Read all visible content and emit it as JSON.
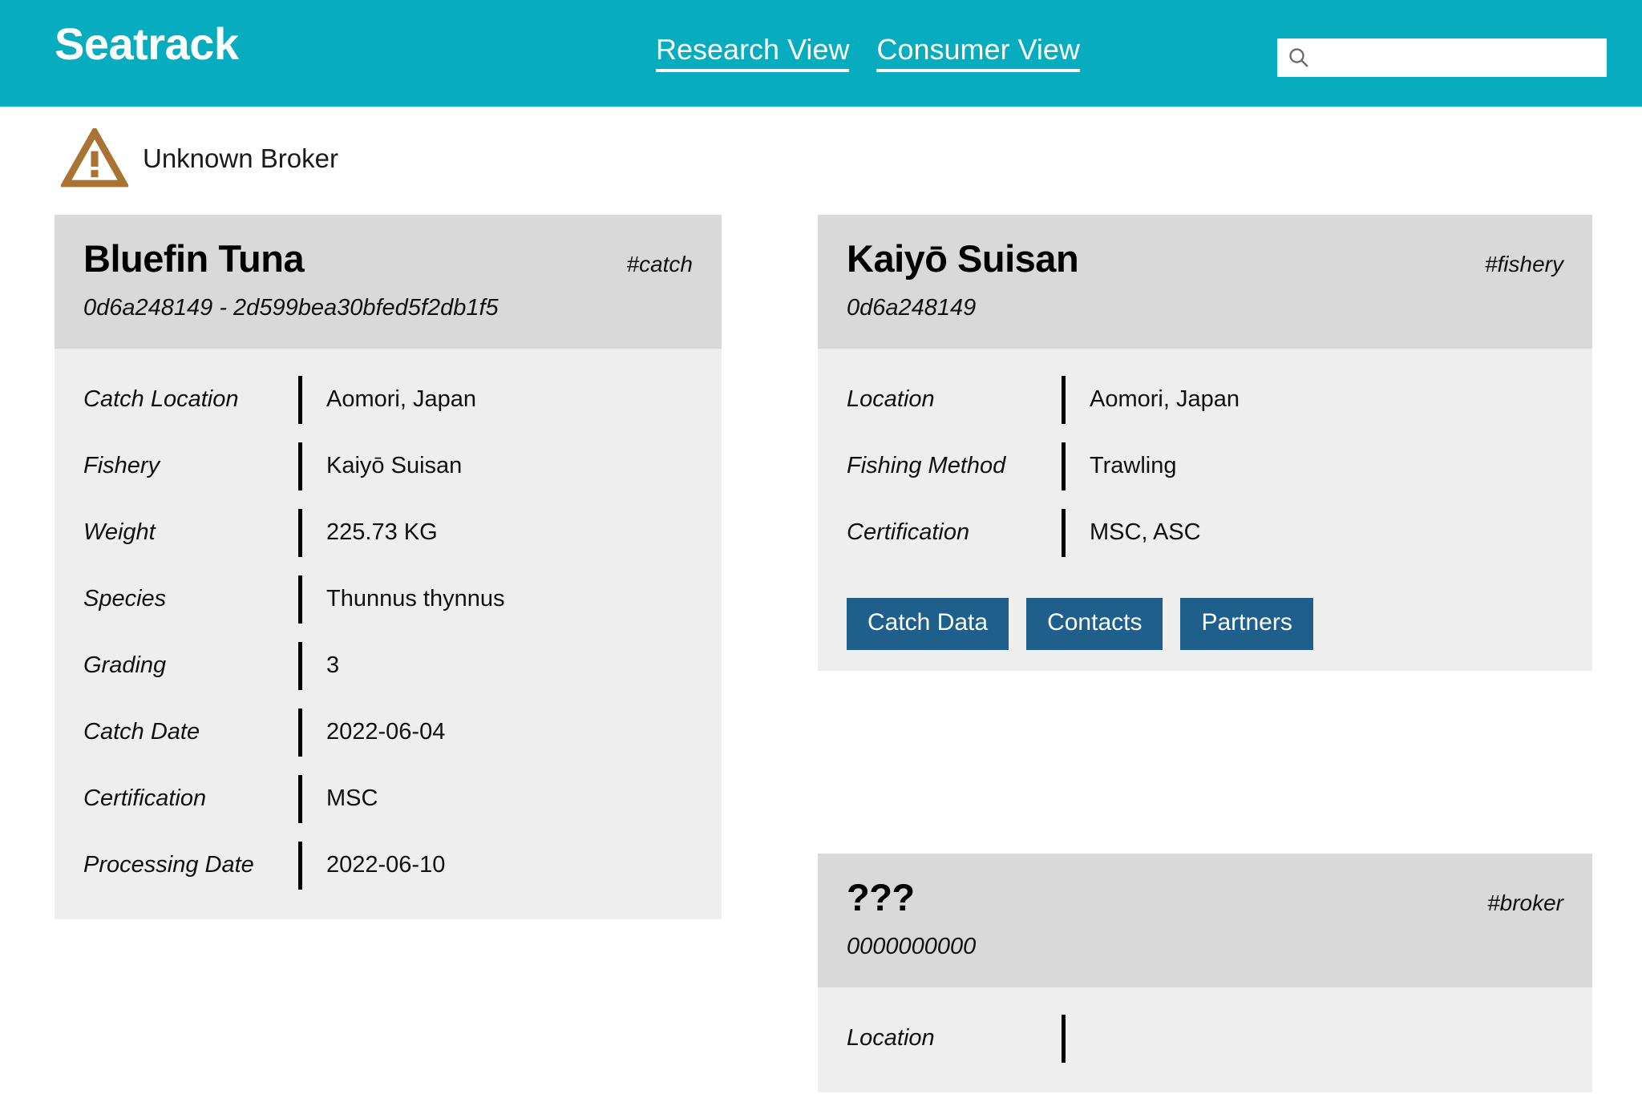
{
  "header": {
    "brand": "Seatrack",
    "brand_color": "#07adbf",
    "nav": [
      {
        "label": "Research View"
      },
      {
        "label": "Consumer View"
      }
    ],
    "search": {
      "value": "",
      "placeholder": "",
      "icon": "search-icon"
    }
  },
  "warning": {
    "icon": "warning-triangle-icon",
    "icon_color": "#a87333",
    "text": "Unknown Broker"
  },
  "cards": {
    "catch": {
      "title": "Bluefin Tuna",
      "tag": "#catch",
      "id": "0d6a248149 - 2d599bea30bfed5f2db1f5",
      "rows": [
        {
          "label": "Catch Location",
          "value": "Aomori, Japan"
        },
        {
          "label": "Fishery",
          "value": "Kaiyō Suisan"
        },
        {
          "label": "Weight",
          "value": "225.73 KG"
        },
        {
          "label": "Species",
          "value": "Thunnus thynnus"
        },
        {
          "label": "Grading",
          "value": "3"
        },
        {
          "label": "Catch Date",
          "value": "2022-06-04"
        },
        {
          "label": "Certification",
          "value": "MSC"
        },
        {
          "label": "Processing Date",
          "value": "2022-06-10"
        }
      ]
    },
    "fishery": {
      "title": "Kaiyō Suisan",
      "tag": "#fishery",
      "id": "0d6a248149",
      "rows": [
        {
          "label": "Location",
          "value": "Aomori, Japan"
        },
        {
          "label": "Fishing Method",
          "value": "Trawling"
        },
        {
          "label": "Certification",
          "value": "MSC, ASC"
        }
      ],
      "actions": [
        {
          "label": "Catch Data"
        },
        {
          "label": "Contacts"
        },
        {
          "label": "Partners"
        }
      ],
      "action_color": "#1f5f8b"
    },
    "broker": {
      "title": "???",
      "tag": "#broker",
      "id": "0000000000",
      "rows": [
        {
          "label": "Location",
          "value": ""
        }
      ]
    }
  }
}
